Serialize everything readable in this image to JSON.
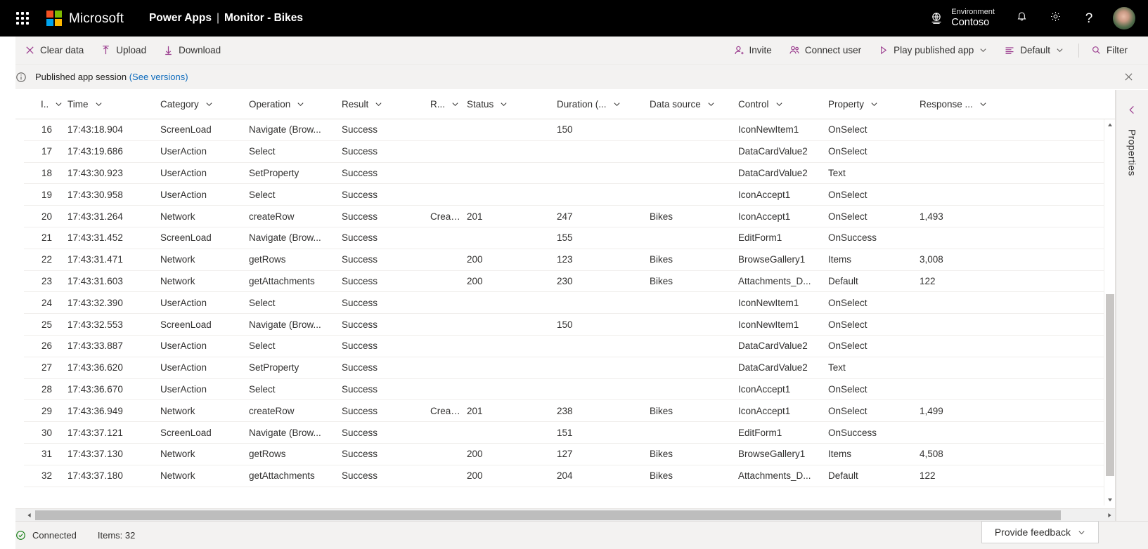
{
  "suitebar": {
    "waffle_label": "App launcher",
    "brand": "Microsoft",
    "product": "Power Apps",
    "separator": "|",
    "page": "Monitor - Bikes",
    "environment_label": "Environment",
    "environment_value": "Contoso",
    "help_glyph": "?",
    "icons": {
      "notifications": "bell-icon",
      "settings": "gear-icon",
      "help": "help-icon",
      "environment": "globe-icon",
      "avatar": "user-avatar"
    }
  },
  "commandbar": {
    "items": [
      {
        "label": "Clear data",
        "icon": "clear-x-icon",
        "chevron": false
      },
      {
        "label": "Upload",
        "icon": "upload-arrow-icon",
        "chevron": false
      },
      {
        "label": "Download",
        "icon": "download-arrow-icon",
        "chevron": false
      }
    ],
    "right_items": [
      {
        "label": "Invite",
        "icon": "person-add-icon",
        "chevron": false
      },
      {
        "label": "Connect user",
        "icon": "people-icon",
        "chevron": false
      },
      {
        "label": "Play published app",
        "icon": "play-triangle-icon",
        "chevron": true
      },
      {
        "label": "Default",
        "icon": "list-lines-icon",
        "chevron": true
      },
      {
        "label": "Filter",
        "icon": "search-icon",
        "chevron": false
      }
    ]
  },
  "messagebar": {
    "icon": "info-circle-icon",
    "text": "Published app session",
    "link": "(See versions)",
    "close_icon": "close-icon"
  },
  "grid": {
    "columns": [
      {
        "key": "id",
        "label": "I..",
        "align": "right"
      },
      {
        "key": "time",
        "label": "Time",
        "align": "left"
      },
      {
        "key": "category",
        "label": "Category",
        "align": "left"
      },
      {
        "key": "operation",
        "label": "Operation",
        "align": "left"
      },
      {
        "key": "result",
        "label": "Result",
        "align": "left"
      },
      {
        "key": "rr",
        "label": "R...",
        "align": "left"
      },
      {
        "key": "status",
        "label": "Status",
        "align": "left"
      },
      {
        "key": "duration",
        "label": "Duration (...",
        "align": "left"
      },
      {
        "key": "source",
        "label": "Data source",
        "align": "left"
      },
      {
        "key": "control",
        "label": "Control",
        "align": "left"
      },
      {
        "key": "property",
        "label": "Property",
        "align": "left"
      },
      {
        "key": "response",
        "label": "Response ...",
        "align": "left"
      }
    ],
    "rows": [
      {
        "id": "16",
        "time": "17:43:18.904",
        "category": "ScreenLoad",
        "operation": "Navigate (Brow...",
        "result": "Success",
        "rr": "",
        "status": "",
        "duration": "150",
        "source": "",
        "control": "IconNewItem1",
        "property": "OnSelect",
        "response": ""
      },
      {
        "id": "17",
        "time": "17:43:19.686",
        "category": "UserAction",
        "operation": "Select",
        "result": "Success",
        "rr": "",
        "status": "",
        "duration": "",
        "source": "",
        "control": "DataCardValue2",
        "property": "OnSelect",
        "response": ""
      },
      {
        "id": "18",
        "time": "17:43:30.923",
        "category": "UserAction",
        "operation": "SetProperty",
        "result": "Success",
        "rr": "",
        "status": "",
        "duration": "",
        "source": "",
        "control": "DataCardValue2",
        "property": "Text",
        "response": ""
      },
      {
        "id": "19",
        "time": "17:43:30.958",
        "category": "UserAction",
        "operation": "Select",
        "result": "Success",
        "rr": "",
        "status": "",
        "duration": "",
        "source": "",
        "control": "IconAccept1",
        "property": "OnSelect",
        "response": ""
      },
      {
        "id": "20",
        "time": "17:43:31.264",
        "category": "Network",
        "operation": "createRow",
        "result": "Success",
        "rr": "Created",
        "status": "201",
        "duration": "247",
        "source": "Bikes",
        "control": "IconAccept1",
        "property": "OnSelect",
        "response": "1,493"
      },
      {
        "id": "21",
        "time": "17:43:31.452",
        "category": "ScreenLoad",
        "operation": "Navigate (Brow...",
        "result": "Success",
        "rr": "",
        "status": "",
        "duration": "155",
        "source": "",
        "control": "EditForm1",
        "property": "OnSuccess",
        "response": ""
      },
      {
        "id": "22",
        "time": "17:43:31.471",
        "category": "Network",
        "operation": "getRows",
        "result": "Success",
        "rr": "",
        "status": "200",
        "duration": "123",
        "source": "Bikes",
        "control": "BrowseGallery1",
        "property": "Items",
        "response": "3,008"
      },
      {
        "id": "23",
        "time": "17:43:31.603",
        "category": "Network",
        "operation": "getAttachments",
        "result": "Success",
        "rr": "",
        "status": "200",
        "duration": "230",
        "source": "Bikes",
        "control": "Attachments_D...",
        "property": "Default",
        "response": "122"
      },
      {
        "id": "24",
        "time": "17:43:32.390",
        "category": "UserAction",
        "operation": "Select",
        "result": "Success",
        "rr": "",
        "status": "",
        "duration": "",
        "source": "",
        "control": "IconNewItem1",
        "property": "OnSelect",
        "response": ""
      },
      {
        "id": "25",
        "time": "17:43:32.553",
        "category": "ScreenLoad",
        "operation": "Navigate (Brow...",
        "result": "Success",
        "rr": "",
        "status": "",
        "duration": "150",
        "source": "",
        "control": "IconNewItem1",
        "property": "OnSelect",
        "response": ""
      },
      {
        "id": "26",
        "time": "17:43:33.887",
        "category": "UserAction",
        "operation": "Select",
        "result": "Success",
        "rr": "",
        "status": "",
        "duration": "",
        "source": "",
        "control": "DataCardValue2",
        "property": "OnSelect",
        "response": ""
      },
      {
        "id": "27",
        "time": "17:43:36.620",
        "category": "UserAction",
        "operation": "SetProperty",
        "result": "Success",
        "rr": "",
        "status": "",
        "duration": "",
        "source": "",
        "control": "DataCardValue2",
        "property": "Text",
        "response": ""
      },
      {
        "id": "28",
        "time": "17:43:36.670",
        "category": "UserAction",
        "operation": "Select",
        "result": "Success",
        "rr": "",
        "status": "",
        "duration": "",
        "source": "",
        "control": "IconAccept1",
        "property": "OnSelect",
        "response": ""
      },
      {
        "id": "29",
        "time": "17:43:36.949",
        "category": "Network",
        "operation": "createRow",
        "result": "Success",
        "rr": "Created",
        "status": "201",
        "duration": "238",
        "source": "Bikes",
        "control": "IconAccept1",
        "property": "OnSelect",
        "response": "1,499"
      },
      {
        "id": "30",
        "time": "17:43:37.121",
        "category": "ScreenLoad",
        "operation": "Navigate (Brow...",
        "result": "Success",
        "rr": "",
        "status": "",
        "duration": "151",
        "source": "",
        "control": "EditForm1",
        "property": "OnSuccess",
        "response": ""
      },
      {
        "id": "31",
        "time": "17:43:37.130",
        "category": "Network",
        "operation": "getRows",
        "result": "Success",
        "rr": "",
        "status": "200",
        "duration": "127",
        "source": "Bikes",
        "control": "BrowseGallery1",
        "property": "Items",
        "response": "4,508"
      },
      {
        "id": "32",
        "time": "17:43:37.180",
        "category": "Network",
        "operation": "getAttachments",
        "result": "Success",
        "rr": "",
        "status": "200",
        "duration": "204",
        "source": "Bikes",
        "control": "Attachments_D...",
        "property": "Default",
        "response": "122"
      }
    ]
  },
  "properties_rail": {
    "label": "Properties",
    "expand_icon": "chevron-left-icon"
  },
  "statusbar": {
    "connection_icon": "check-circle-icon",
    "connection_text": "Connected",
    "items_text": "Items: 32",
    "feedback_label": "Provide feedback"
  },
  "colors": {
    "accent": "#9b3d8f",
    "link": "#0f6cbd",
    "success": "#107c10",
    "suite_bg": "#000000",
    "chrome_bg": "#f3f2f1"
  }
}
